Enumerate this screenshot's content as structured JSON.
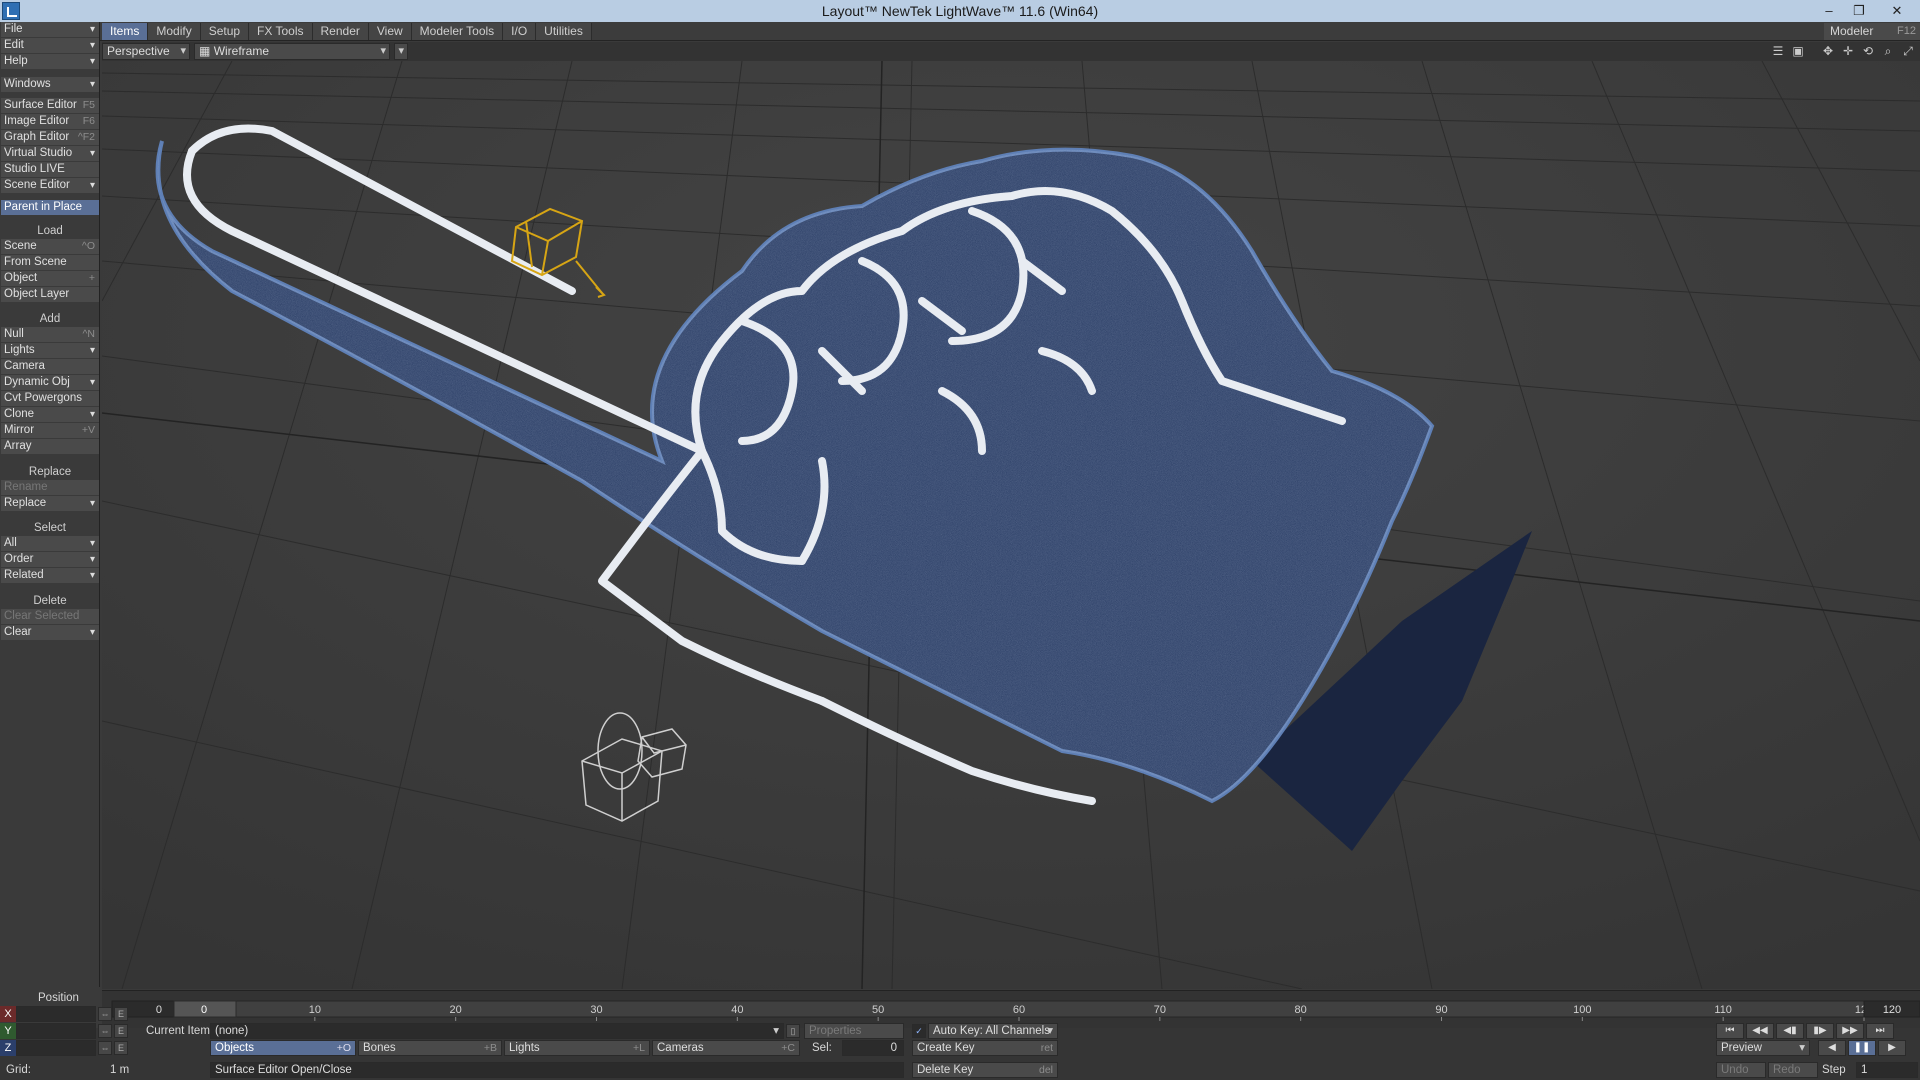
{
  "window": {
    "title": "Layout™ NewTek LightWave™ 11.6 (Win64)",
    "minimize": "–",
    "restore": "❐",
    "close": "✕"
  },
  "tabs": [
    "Items",
    "Modify",
    "Setup",
    "FX Tools",
    "Render",
    "View",
    "Modeler Tools",
    "I/O",
    "Utilities"
  ],
  "active_tab": "Items",
  "modeler": {
    "label": "Modeler",
    "shortcut": "F12"
  },
  "viewport": {
    "view_mode": "Perspective",
    "render_mode": "Wireframe",
    "render_icon": "▦"
  },
  "left_menu": {
    "file": "File",
    "edit": "Edit",
    "help": "Help",
    "windows": "Windows",
    "surface_editor": "Surface Editor",
    "surface_editor_sc": "F5",
    "image_editor": "Image Editor",
    "image_editor_sc": "F6",
    "graph_editor": "Graph Editor",
    "graph_editor_sc": "^F2",
    "virtual_studio": "Virtual Studio",
    "studio_live": "Studio LIVE",
    "scene_editor": "Scene Editor",
    "parent_in_place": "Parent in Place",
    "load_group": "Load",
    "scene": "Scene",
    "scene_sc": "^O",
    "from_scene": "From Scene",
    "object": "Object",
    "object_sc": "+",
    "object_layer": "Object Layer",
    "add_group": "Add",
    "null": "Null",
    "null_sc": "^N",
    "lights": "Lights",
    "camera": "Camera",
    "dynamic_obj": "Dynamic Obj",
    "cvt_powergons": "Cvt Powergons",
    "clone": "Clone",
    "mirror": "Mirror",
    "mirror_sc": "+V",
    "array": "Array",
    "replace_group": "Replace",
    "rename": "Rename",
    "replace": "Replace",
    "select_group": "Select",
    "all": "All",
    "order": "Order",
    "related": "Related",
    "delete_group": "Delete",
    "clear_selected": "Clear Selected",
    "clear": "Clear"
  },
  "timeline": {
    "start_frame": "0",
    "current_frame": "0",
    "end_frame": "120",
    "ticks": [
      "10",
      "20",
      "30",
      "40",
      "50",
      "60",
      "70",
      "80",
      "90",
      "100",
      "110",
      "120"
    ],
    "tick_values": [
      10,
      20,
      30,
      40,
      50,
      60,
      70,
      80,
      90,
      100,
      110,
      120
    ]
  },
  "bottom": {
    "position_label": "Position",
    "axis_x": "X",
    "axis_y": "Y",
    "axis_z": "Z",
    "e": "E",
    "current_item_label": "Current Item",
    "current_item_value": "(none)",
    "properties": "Properties",
    "objects": "Objects",
    "objects_sc": "+O",
    "bones": "Bones",
    "bones_sc": "+B",
    "lights": "Lights",
    "lights_sc": "+L",
    "cameras": "Cameras",
    "cameras_sc": "+C",
    "sel_label": "Sel:",
    "sel_value": "0",
    "auto_key": "Auto Key: All Channels",
    "create_key": "Create Key",
    "create_key_sc": "ret",
    "delete_key": "Delete Key",
    "delete_key_sc": "del",
    "grid_label": "Grid:",
    "grid_value": "1 m",
    "status": "Surface Editor Open/Close",
    "preview": "Preview",
    "undo": "Undo",
    "redo": "Redo",
    "step_label": "Step",
    "step_value": "1"
  },
  "colors": {
    "accent": "#5a6f96",
    "foam": "#22365f",
    "stroke": "#e8ecf2",
    "light_wire": "#d7a514"
  }
}
